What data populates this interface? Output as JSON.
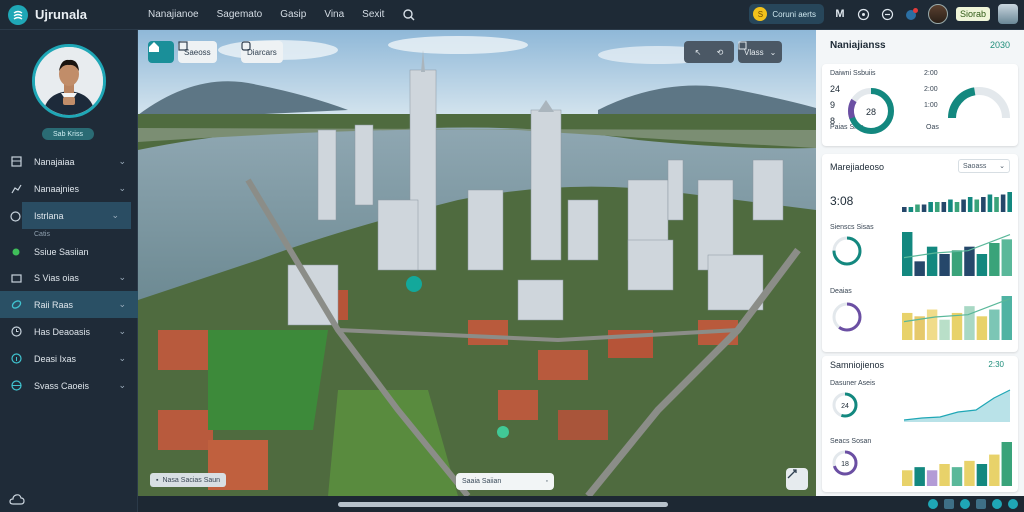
{
  "app": {
    "title": "Ujrunala"
  },
  "nav": {
    "items": [
      "Nanajianoe",
      "Sagemato",
      "Gasip",
      "Vina",
      "Sexit"
    ]
  },
  "topbar": {
    "pill_label": "Coruni aerts",
    "pill_badge": "S",
    "icon_label": "M",
    "user_name": "Siorab"
  },
  "profile": {
    "badge": "Sab Kriss"
  },
  "sidebar": {
    "items": [
      {
        "label": "Nanajaiaa",
        "icon": "grid-icon"
      },
      {
        "label": "Nanaajnies",
        "icon": "chart-icon"
      },
      {
        "label": "Istrlana",
        "icon": "circle-icon",
        "sub": "Catis"
      },
      {
        "label": "Ssiue Sasiian",
        "icon": "dot-icon"
      },
      {
        "label": "S Vias oias",
        "icon": "folder-icon"
      },
      {
        "label": "Raii Raas",
        "icon": "link-icon"
      },
      {
        "label": "Has Deaoasis",
        "icon": "clock-icon"
      },
      {
        "label": "Deasi Ixas",
        "icon": "info-icon"
      },
      {
        "label": "Svass Caoeis",
        "icon": "globe-icon"
      }
    ]
  },
  "map": {
    "home_btn": "",
    "btn1": "Saeoss",
    "btn2": "Diarcars",
    "ctrl_label": "Vlass",
    "search_text": "Saaia Saiian",
    "status": "Nasa Sacias Saun"
  },
  "panel": {
    "header_title": "Naniajianss",
    "header_value": "2030",
    "card1": {
      "labels": [
        "Daiwni Ssbuiis",
        "Paias Srss",
        "Oas"
      ],
      "values": [
        "2:00",
        "2:00",
        "1:00"
      ],
      "side_nums": [
        "24",
        "9",
        "8"
      ],
      "gauge1_pct": 70,
      "gauge2_pct": 45,
      "small_val": "28"
    },
    "card2": {
      "title": "Marejiadeoso",
      "dropdown": "Saoass",
      "big_num": "3:08",
      "label1": "Sienscs Sisas",
      "label2": "Deaias",
      "ring1_pct": 75,
      "ring2_pct": 60
    },
    "card3": {
      "title": "Samniojienos",
      "value": "2:30",
      "label1": "Dasuner Aseis",
      "label2": "Seacs Sosan",
      "ring1_val": "24",
      "ring2_val": "18",
      "ring1_pct": 55,
      "ring2_pct": 70
    }
  },
  "chart_data": [
    {
      "type": "bar",
      "name": "card2-bars-top",
      "values": [
        2,
        2,
        3,
        3,
        4,
        4,
        4,
        5,
        4,
        5,
        6,
        5,
        6,
        7,
        6,
        7,
        8
      ]
    },
    {
      "type": "bar",
      "name": "card2-bars-mid",
      "values": [
        12,
        4,
        8,
        6,
        7,
        8,
        6,
        9,
        10
      ]
    },
    {
      "type": "bar",
      "name": "card2-bars-low",
      "values": [
        8,
        7,
        9,
        6,
        8,
        10,
        7,
        9,
        13
      ]
    },
    {
      "type": "bar",
      "name": "card3-bars-low",
      "values": [
        5,
        6,
        5,
        7,
        6,
        8,
        7,
        10,
        14
      ]
    }
  ],
  "colors": {
    "accent": "#1fa7b6",
    "sidebar": "#1f2b38",
    "teal": "#13887f",
    "navy": "#25476a",
    "yellow": "#e8d26a"
  }
}
